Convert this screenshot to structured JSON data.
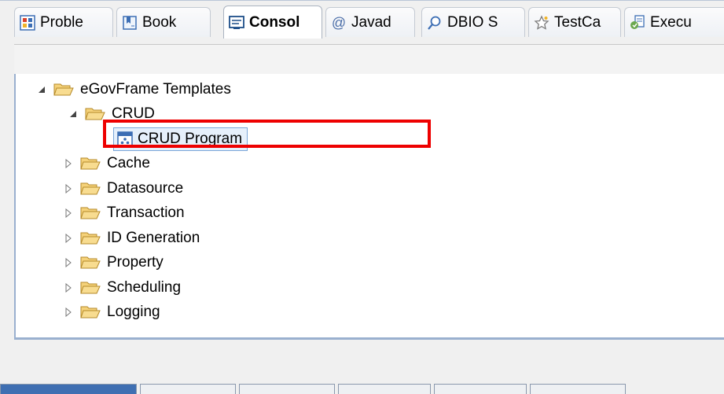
{
  "tabs": [
    {
      "label": "Proble",
      "icon": "problems-icon"
    },
    {
      "label": "Book",
      "icon": "bookmarks-icon"
    },
    {
      "label": "Consol",
      "icon": "console-icon",
      "active": true
    },
    {
      "label": "Javad",
      "icon": "javadoc-icon"
    },
    {
      "label": "DBIO S",
      "icon": "dbio-search-icon"
    },
    {
      "label": "TestCa",
      "icon": "testcase-icon"
    },
    {
      "label": "Execu",
      "icon": "execution-icon"
    }
  ],
  "tree": {
    "root": "eGovFrame Templates",
    "crud": "CRUD",
    "crud_program": "CRUD Program",
    "cache": "Cache",
    "datasource": "Datasource",
    "transaction": "Transaction",
    "id_generation": "ID Generation",
    "property": "Property",
    "scheduling": "Scheduling",
    "logging": "Logging"
  },
  "colors": {
    "highlight": "#ee0000",
    "folder": "#f5c85a",
    "selection": "#e6f0fb",
    "panel_border": "#9ab0cf"
  }
}
